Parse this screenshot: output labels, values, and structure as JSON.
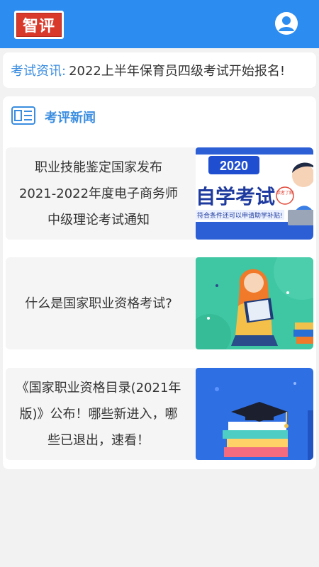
{
  "app": {
    "logo_text": "智评",
    "brand_color": "#2d8cf0",
    "accent_color": "#3b8de0"
  },
  "ticker": {
    "label": "考试资讯:",
    "text": "2022上半年保育员四级考试开始报名!"
  },
  "news": {
    "section_title": "考评新闻",
    "items": [
      {
        "title": "职业技能鉴定国家发布 2021-2022年度电子商务师中级理论考试通知",
        "thumb": "self-study-exam-banner",
        "thumb_year": "2020",
        "thumb_headline": "自学考试",
        "thumb_sub": "符合条件还可以申请助学补贴!",
        "thumb_badge": "读者了解"
      },
      {
        "title": "什么是国家职业资格考试?",
        "thumb": "girl-reading-illustration"
      },
      {
        "title": "《国家职业资格目录(2021年版)》公布！哪些新进入，哪些已退出，速看！",
        "thumb": "graduation-cap-books-illustration"
      }
    ]
  }
}
